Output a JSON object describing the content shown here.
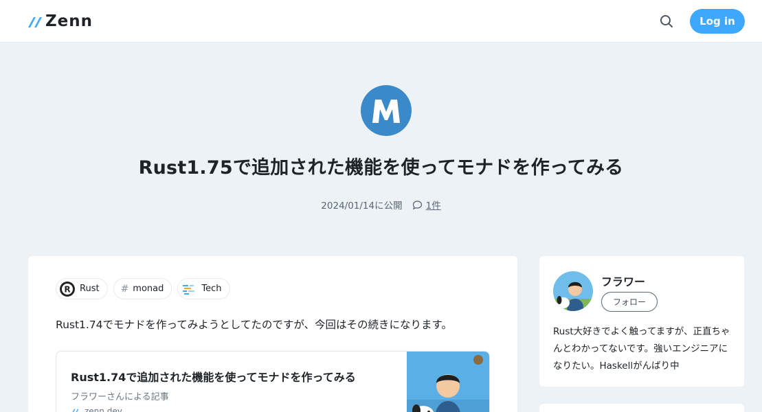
{
  "header": {
    "logo_text": "Zenn",
    "search_icon": "search-icon",
    "login_label": "Log in",
    "accent_color": "#3ea8ff"
  },
  "article": {
    "emoji_icon": "letter-m-emoji-icon",
    "title": "Rust1.75で追加された機能を使ってモナドを作ってみる",
    "published": "2024/01/14に公開",
    "comment_icon": "comment-bubble-icon",
    "comment_count": "1件",
    "topics": [
      {
        "label": "Rust",
        "icon": "rust-logo-icon"
      },
      {
        "label": "monad",
        "icon": "hash-icon"
      },
      {
        "label": "Tech",
        "icon": "tech-icon"
      }
    ],
    "intro": "Rust1.74でモナドを作ってみようとしてたのですが、今回はその続きになります。",
    "link_card": {
      "title": "Rust1.74で追加された機能を使ってモナドを作ってみる",
      "description": "フラワーさんによる記事",
      "domain": "zenn.dev",
      "thumbnail": "author-illustration-thumbnail"
    }
  },
  "author": {
    "avatar": "author-avatar-illustration",
    "name": "フラワー",
    "follow_label": "フォロー",
    "bio": "Rust大好きでよく触ってますが、正直ちゃんとわかってないです。強いエンジニアになりたい。Haskellがんばり中"
  }
}
